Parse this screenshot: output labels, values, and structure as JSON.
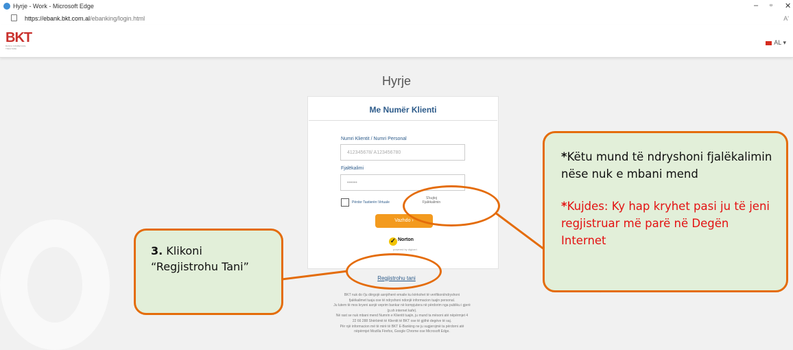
{
  "window": {
    "title": "Hyrje - Work - Microsoft Edge",
    "minimize": "–",
    "maximize": "▫",
    "close": "✕"
  },
  "address_bar": {
    "url_host": "https://ebank.bkt.com.al",
    "url_path": "/ebanking/login.html",
    "reader_icon": "Aʹ"
  },
  "header": {
    "logo_text": "BKT",
    "logo_subtitle": "BANKA KOMBETARE TREGTARE",
    "language": "AL ▾"
  },
  "page": {
    "title": "Hyrje"
  },
  "login_card": {
    "title": "Me Numër Klienti",
    "client_label": "Numri Klientit / Numri Personal",
    "client_placeholder": "412345678/ A123456780",
    "password_label": "Fjalëkalimi",
    "password_value": "••••••",
    "virtual_keyboard_label": "Përdor Tastierën Virtuale",
    "forgot_password_line1": "S'kujtoj",
    "forgot_password_line2": "Fjalëkalimin",
    "continue_button": "Vazhdo ›",
    "norton_name": "Norton",
    "norton_powered": "powered by digicert"
  },
  "register_link": "Regjistrohu tani",
  "footer_lines": [
    "BKT nuk do t'ju dërgojë asnjëherë emaile ku kërkohet të verifikoni/ndryshoni",
    "fjalëkalimet tuaja ose të ndryshoni ndonjë informacion tuajin personal.",
    "Ju lutem të mos kryeni asnjë veprim bankar në kompjutera në përdorim nga publiku i gjerë",
    "(p.sh internet kafe).",
    "Në rast se nuk mbani mend Numrin e Klientit tuajin, ju mund ta mësoni atë nëpërmjet 4",
    "22 66 288 Shërbimit të Klientit të BKT ose të gjithë degëve të saj.",
    "Për një informacion më të mirë të BKT E-Banking ne ju sugjerojmë ta përdorni atë",
    "nëpërmjet Mozilla Firefox, Google Chrome ose Microsoft Edge."
  ],
  "callouts": {
    "left_number": "3.",
    "left_text": " Klikoni “Regjistrohu Tani”",
    "right_star1": "*",
    "right_text1": "Këtu mund të ndryshoni fjalëkalimin nëse nuk e mbani mend",
    "right_star2": "*",
    "right_text2": "Kujdes: Ky hap kryhet pasi ju të jeni regjistruar më parë në Degën Internet"
  },
  "colors": {
    "accent_orange": "#f39a1e",
    "callout_border": "#e46c0a",
    "callout_fill": "#e2efd9",
    "link_blue": "#2d5b8a",
    "warning_red": "#e31212"
  }
}
